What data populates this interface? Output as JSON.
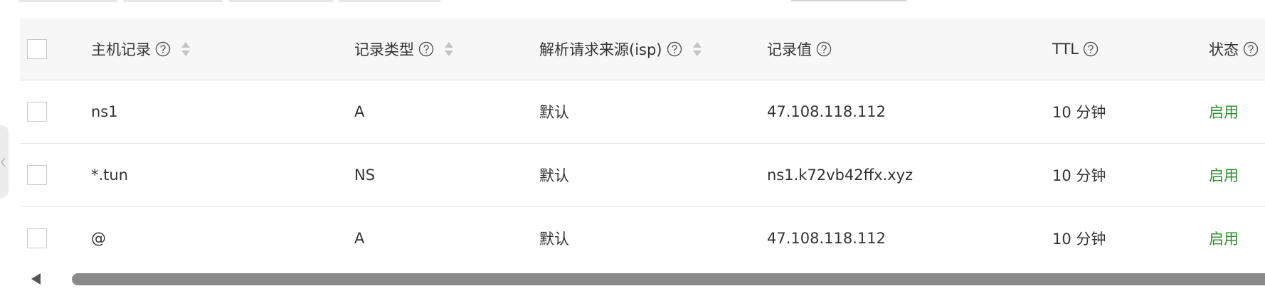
{
  "table": {
    "columns": [
      {
        "label": "主机记录",
        "help": true,
        "sortable": true
      },
      {
        "label": "记录类型",
        "help": true,
        "sortable": true
      },
      {
        "label": "解析请求来源(isp)",
        "help": true,
        "sortable": true
      },
      {
        "label": "记录值",
        "help": true,
        "sortable": false
      },
      {
        "label": "TTL",
        "help": true,
        "sortable": false
      },
      {
        "label": "状态",
        "help": true,
        "sortable": false
      }
    ],
    "rows": [
      {
        "host": "ns1",
        "type": "A",
        "isp": "默认",
        "value": "47.108.118.112",
        "ttl": "10 分钟",
        "status": "启用"
      },
      {
        "host": "*.tun",
        "type": "NS",
        "isp": "默认",
        "value": "ns1.k72vb42ffx.xyz",
        "ttl": "10 分钟",
        "status": "启用"
      },
      {
        "host": "@",
        "type": "A",
        "isp": "默认",
        "value": "47.108.118.112",
        "ttl": "10 分钟",
        "status": "启用"
      }
    ]
  },
  "colors": {
    "status_enabled": "#2f8f2f",
    "header_bg": "#f7f7f7",
    "scroll_thumb": "#8a8a8a"
  },
  "icons": [
    "question-circle-icon",
    "sort-icon",
    "chevron-left-icon",
    "scroll-left-arrow-icon"
  ]
}
